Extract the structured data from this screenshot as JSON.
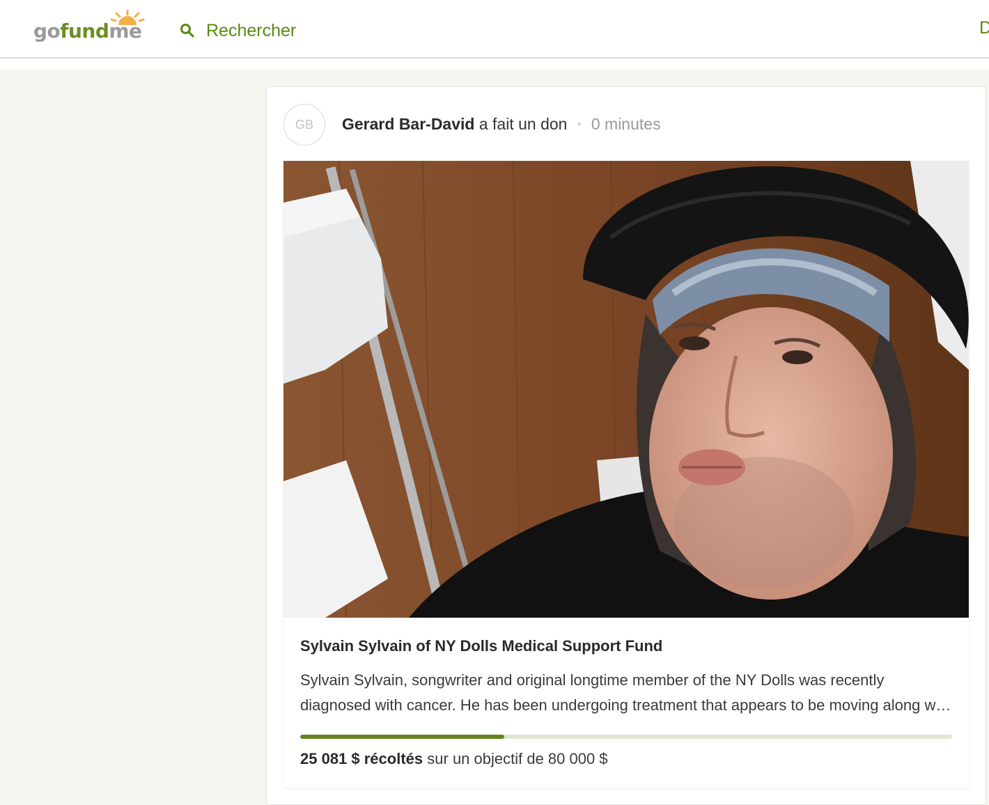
{
  "header": {
    "logo": {
      "go": "go",
      "fund": "fund",
      "me": "me"
    },
    "search_label": "Rechercher",
    "search_icon": "search-icon",
    "right_cut": "D"
  },
  "feed_item": {
    "avatar_initials": "GB",
    "donor_name": "Gerard Bar-David",
    "action": "a fait un don",
    "separator": "•",
    "time": "0 minutes",
    "campaign": {
      "title": "Sylvain Sylvain of NY Dolls Medical Support Fund",
      "description": "Sylvain Sylvain, songwriter and original longtime member of the NY Dolls was recently diagnosed with cancer. He has been undergoing treatment that appears to be moving along well and we are hopeful of a good outcome.",
      "raised": "25 081 $ récoltés",
      "goal_text": "sur un objectif de 80 000 $",
      "progress_fraction": 0.3135
    }
  },
  "colors": {
    "brand_green": "#5a8a12",
    "progress_fill": "#63871b",
    "progress_track": "#dfe6d3",
    "page_bg": "#f6f6f1"
  }
}
